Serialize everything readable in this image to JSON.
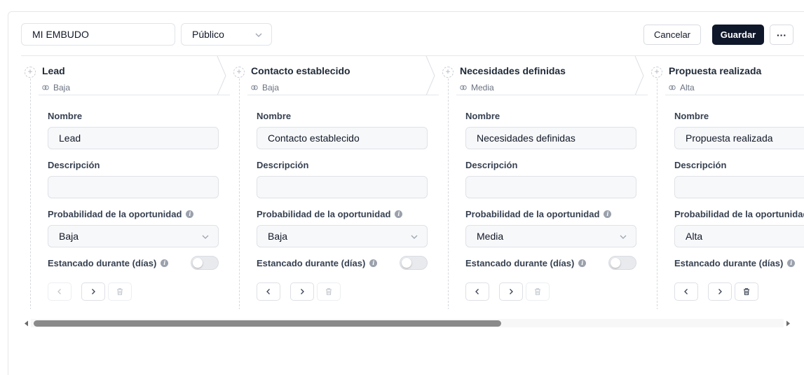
{
  "toolbar": {
    "pipeline_name": "MI EMBUDO",
    "visibility": "Público",
    "cancel_label": "Cancelar",
    "save_label": "Guardar",
    "more_label": "···"
  },
  "labels": {
    "name": "Nombre",
    "description": "Descripción",
    "probability": "Probabilidad de la oportunidad",
    "stale": "Estancado durante (días)"
  },
  "stages": [
    {
      "title": "Lead",
      "probability": "Baja",
      "name_value": "Lead",
      "description_value": ""
    },
    {
      "title": "Contacto establecido",
      "probability": "Baja",
      "name_value": "Contacto establecido",
      "description_value": ""
    },
    {
      "title": "Necesidades definidas",
      "probability": "Media",
      "name_value": "Necesidades definidas",
      "description_value": ""
    },
    {
      "title": "Propuesta realizada",
      "probability": "Alta",
      "name_value": "Propuesta realizada",
      "description_value": ""
    }
  ],
  "icons": {
    "plus": "+",
    "info": "i"
  },
  "colors": {
    "primary": "#0f172a",
    "border": "#e5e7eb",
    "muted_text": "#6b7280",
    "scroll_thumb": "#8a8a8a"
  }
}
